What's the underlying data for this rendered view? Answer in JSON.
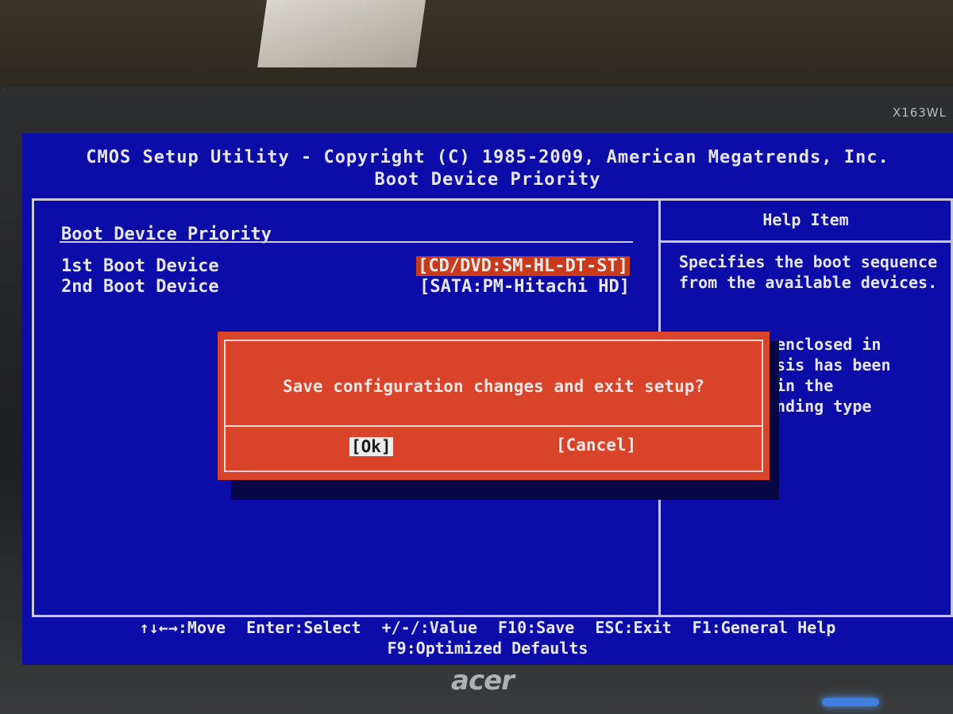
{
  "screen": {
    "title_line1": "CMOS Setup Utility - Copyright (C) 1985-2009, American Megatrends, Inc.",
    "title_line2": "Boot Device Priority"
  },
  "left_panel": {
    "section_title": "Boot Device Priority",
    "rows": [
      {
        "label": "1st Boot Device",
        "value": "[CD/DVD:SM-HL-DT-ST]"
      },
      {
        "label": "2nd Boot Device",
        "value": "[SATA:PM-Hitachi HD]"
      }
    ]
  },
  "help_panel": {
    "title": "Help Item",
    "text": "Specifies the boot sequence from the available devices.",
    "partial_lines": [
      "enclosed in",
      "sis has been",
      "in the",
      "nding type"
    ]
  },
  "dialog": {
    "message": "Save configuration changes and exit setup?",
    "ok_label": "[Ok]",
    "cancel_label": "[Cancel]"
  },
  "footer": {
    "keys": [
      "↑↓←→:Move",
      "Enter:Select",
      "+/-/:Value",
      "F10:Save",
      "ESC:Exit",
      "F1:General Help"
    ],
    "line2": "F9:Optimized Defaults"
  },
  "monitor": {
    "model": "X163WL",
    "brand": "acer"
  },
  "colors": {
    "bios_blue": "#0c0ca8",
    "dialog_red": "#d8432a",
    "highlight_red": "#c83a1c",
    "text_light": "#e6e6f0"
  }
}
